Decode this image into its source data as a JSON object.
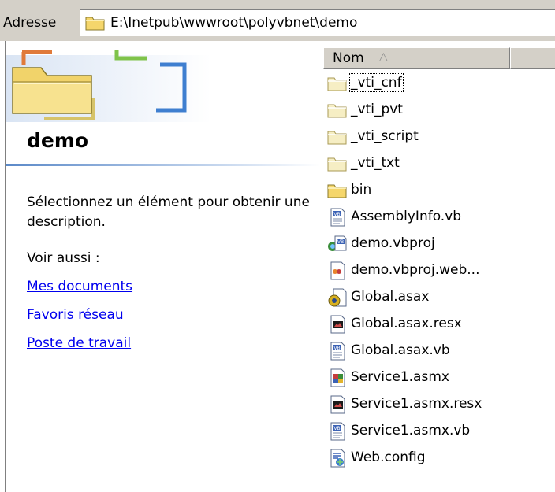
{
  "address": {
    "label": "Adresse",
    "path": "E:\\Inetpub\\wwwroot\\polyvbnet\\demo"
  },
  "pane": {
    "title": "demo",
    "description": "Sélectionnez un élément pour obtenir une description.",
    "see_also": "Voir aussi :",
    "links": [
      "Mes documents",
      "Favoris réseau",
      "Poste de travail"
    ]
  },
  "list": {
    "column_name": "Nom",
    "sort_glyph": "△",
    "items": [
      {
        "name": "_vti_cnf",
        "icon": "folder-light-icon",
        "focused": true
      },
      {
        "name": "_vti_pvt",
        "icon": "folder-light-icon"
      },
      {
        "name": "_vti_script",
        "icon": "folder-light-icon"
      },
      {
        "name": "_vti_txt",
        "icon": "folder-light-icon"
      },
      {
        "name": "bin",
        "icon": "folder-icon"
      },
      {
        "name": "AssemblyInfo.vb",
        "icon": "vb-file-icon"
      },
      {
        "name": "demo.vbproj",
        "icon": "vbproj-icon"
      },
      {
        "name": "demo.vbproj.web...",
        "icon": "webinfo-file-icon"
      },
      {
        "name": "Global.asax",
        "icon": "gear-file-icon"
      },
      {
        "name": "Global.asax.resx",
        "icon": "resx-file-icon"
      },
      {
        "name": "Global.asax.vb",
        "icon": "vb-file-icon"
      },
      {
        "name": "Service1.asmx",
        "icon": "asmx-file-icon"
      },
      {
        "name": "Service1.asmx.resx",
        "icon": "resx-file-icon"
      },
      {
        "name": "Service1.asmx.vb",
        "icon": "vb-file-icon"
      },
      {
        "name": "Web.config",
        "icon": "config-file-icon"
      }
    ]
  },
  "colors": {
    "link": "#0000ee",
    "chrome": "#d4d0c8",
    "folder": "#f5d66b",
    "accent": "#5b89c8"
  }
}
